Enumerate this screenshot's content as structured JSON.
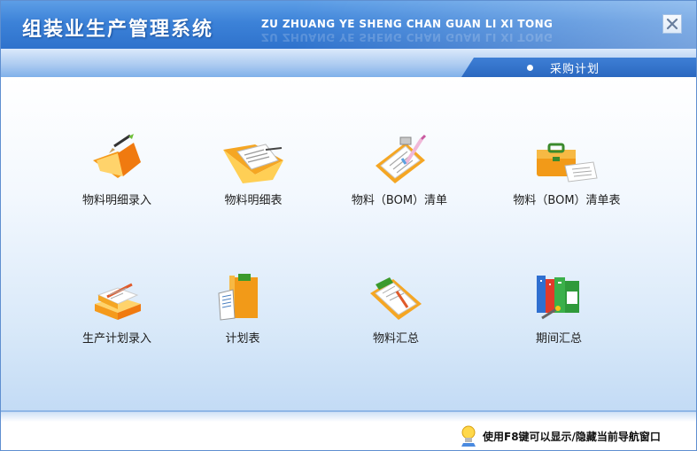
{
  "header": {
    "title": "组装业生产管理系统",
    "subtitle": "ZU ZHUANG YE SHENG CHAN GUAN LI XI TONG",
    "close_icon": "close-icon"
  },
  "breadcrumb": {
    "label": "采购计划"
  },
  "tiles": [
    {
      "label": "物料明细录入",
      "icon": "folder-pen-icon"
    },
    {
      "label": "物料明细表",
      "icon": "folder-document-icon"
    },
    {
      "label": "物料（BOM）清单",
      "icon": "clipboard-icon"
    },
    {
      "label": "物料（BOM）清单表",
      "icon": "briefcase-icon"
    },
    {
      "label": "生产计划录入",
      "icon": "books-pen-icon"
    },
    {
      "label": "计划表",
      "icon": "binder-icon"
    },
    {
      "label": "物料汇总",
      "icon": "clipboard-summary-icon"
    },
    {
      "label": "期间汇总",
      "icon": "bookshelf-icon"
    }
  ],
  "footer": {
    "hint": "使用F8键可以显示/隐藏当前导航窗口",
    "hint_icon": "lightbulb-icon"
  },
  "colors": {
    "header_blue": "#3c82d8",
    "tab_blue": "#2b68c0",
    "icon_orange": "#f7a21b"
  }
}
